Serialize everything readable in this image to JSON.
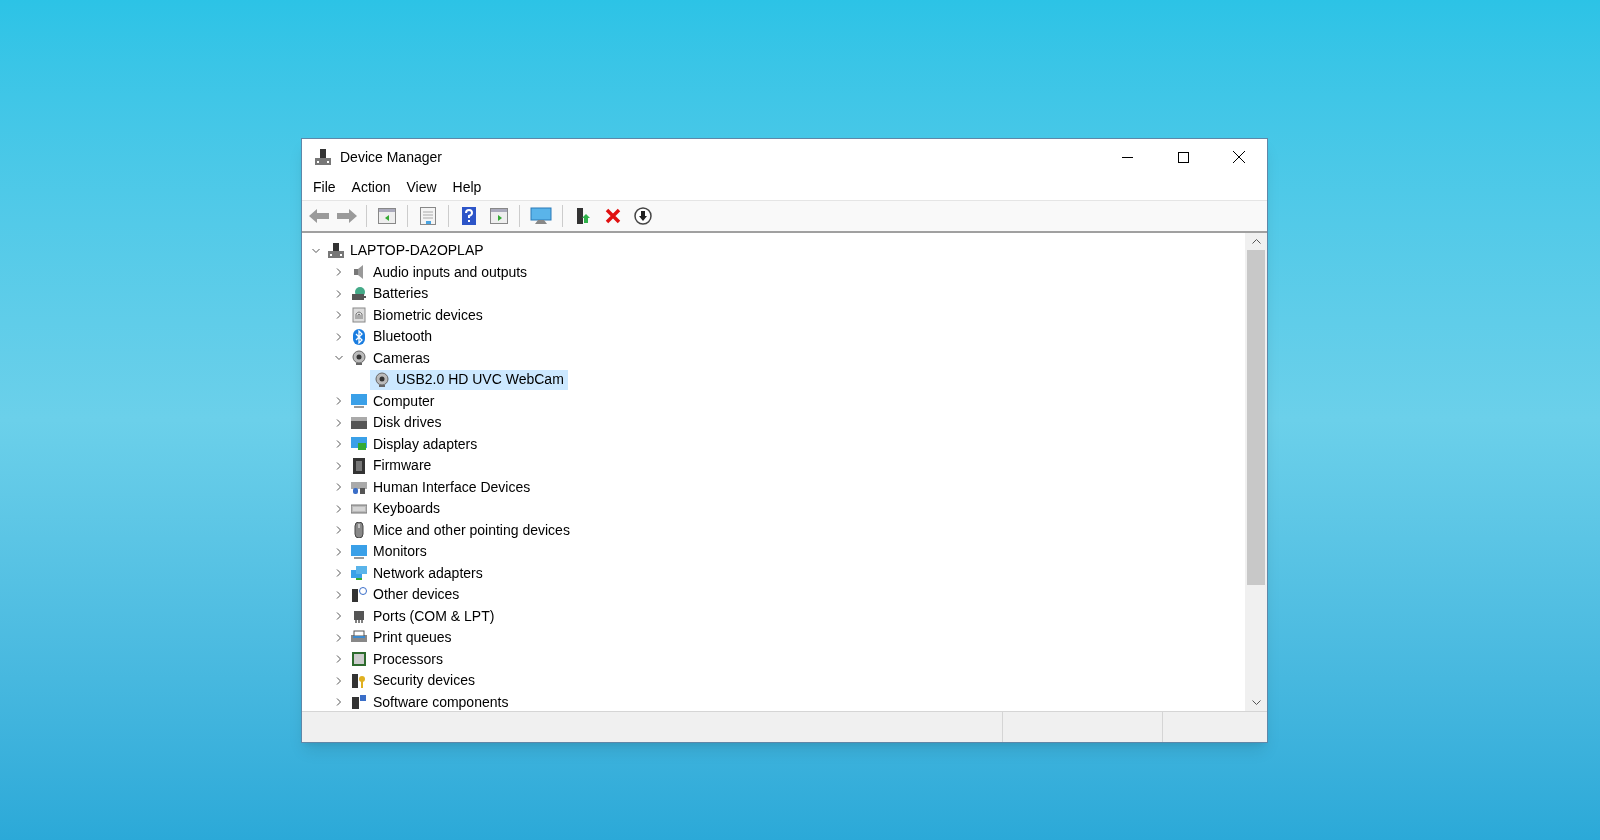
{
  "window": {
    "title": "Device Manager"
  },
  "menu": [
    "File",
    "Action",
    "View",
    "Help"
  ],
  "tree": {
    "label": "LAPTOP-DA2OPLAP",
    "expanded": true,
    "selected": false,
    "children": [
      {
        "label": "Audio inputs and outputs",
        "expanded": false,
        "selected": false
      },
      {
        "label": "Batteries",
        "expanded": false,
        "selected": false
      },
      {
        "label": "Biometric devices",
        "expanded": false,
        "selected": false
      },
      {
        "label": "Bluetooth",
        "expanded": false,
        "selected": false
      },
      {
        "label": "Cameras",
        "expanded": true,
        "selected": false,
        "children": [
          {
            "label": "USB2.0 HD UVC WebCam",
            "selected": true
          }
        ]
      },
      {
        "label": "Computer",
        "expanded": false,
        "selected": false
      },
      {
        "label": "Disk drives",
        "expanded": false,
        "selected": false
      },
      {
        "label": "Display adapters",
        "expanded": false,
        "selected": false
      },
      {
        "label": "Firmware",
        "expanded": false,
        "selected": false
      },
      {
        "label": "Human Interface Devices",
        "expanded": false,
        "selected": false
      },
      {
        "label": "Keyboards",
        "expanded": false,
        "selected": false
      },
      {
        "label": "Mice and other pointing devices",
        "expanded": false,
        "selected": false
      },
      {
        "label": "Monitors",
        "expanded": false,
        "selected": false
      },
      {
        "label": "Network adapters",
        "expanded": false,
        "selected": false
      },
      {
        "label": "Other devices",
        "expanded": false,
        "selected": false
      },
      {
        "label": "Ports (COM & LPT)",
        "expanded": false,
        "selected": false
      },
      {
        "label": "Print queues",
        "expanded": false,
        "selected": false
      },
      {
        "label": "Processors",
        "expanded": false,
        "selected": false
      },
      {
        "label": "Security devices",
        "expanded": false,
        "selected": false
      },
      {
        "label": "Software components",
        "expanded": false,
        "selected": false
      }
    ]
  }
}
